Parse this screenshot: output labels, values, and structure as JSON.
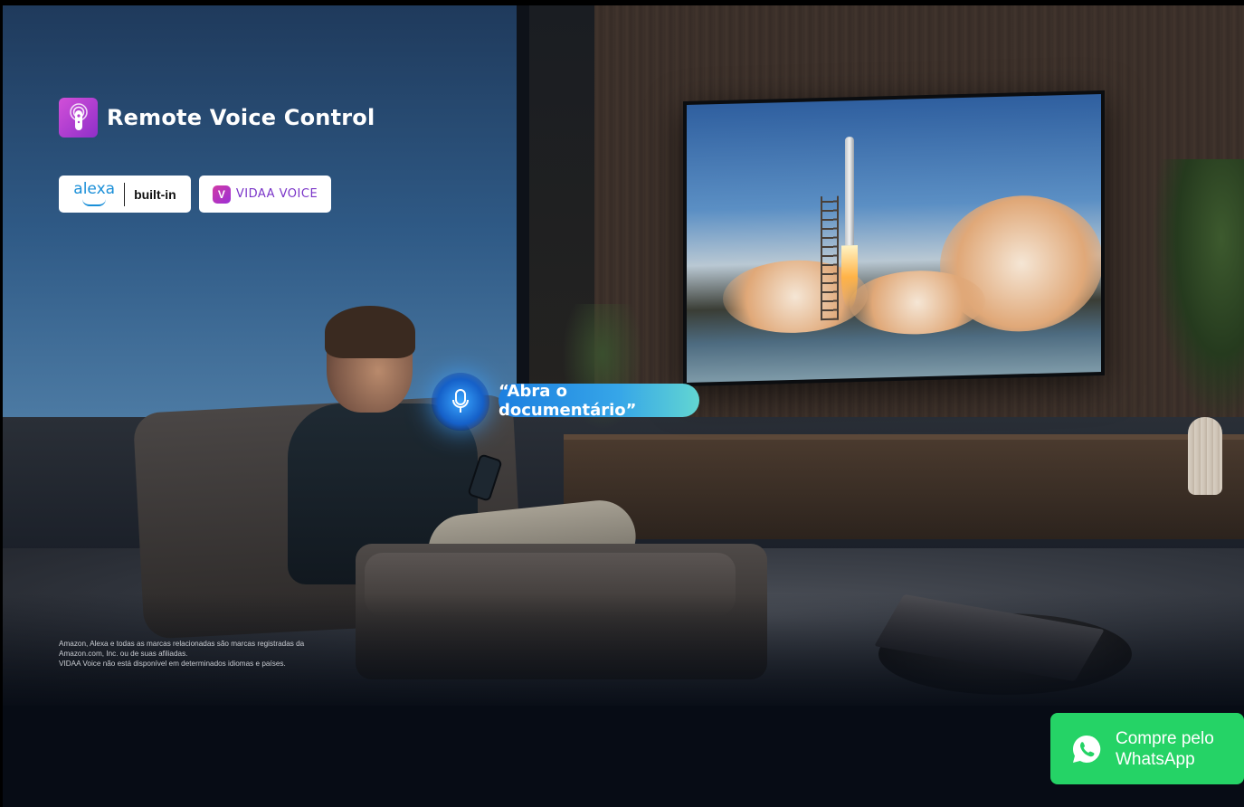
{
  "hero": {
    "feature_title": "Remote Voice Control",
    "feature_icon": "remote-voice-icon",
    "badges": {
      "alexa_word": "alexa",
      "alexa_suffix": "built-in",
      "vidaa_text": "VIDAA VOICE",
      "vidaa_logo_letter": "V"
    },
    "voice_command": "“Abra o documentário”",
    "mic_icon": "microphone-icon",
    "legal_lines": [
      "Amazon, Alexa e todas as marcas relacionadas são marcas registradas da",
      "Amazon.com, Inc. ou de suas afiliadas.",
      "VIDAA Voice não está disponível em determinados idiomas e países."
    ]
  },
  "whatsapp_button": {
    "line1": "Compre pelo",
    "line2": "WhatsApp",
    "icon": "whatsapp-icon",
    "color": "#25d366"
  },
  "colors": {
    "accent_blue": "#1d7fe0",
    "accent_purple": "#8f2fc9"
  }
}
